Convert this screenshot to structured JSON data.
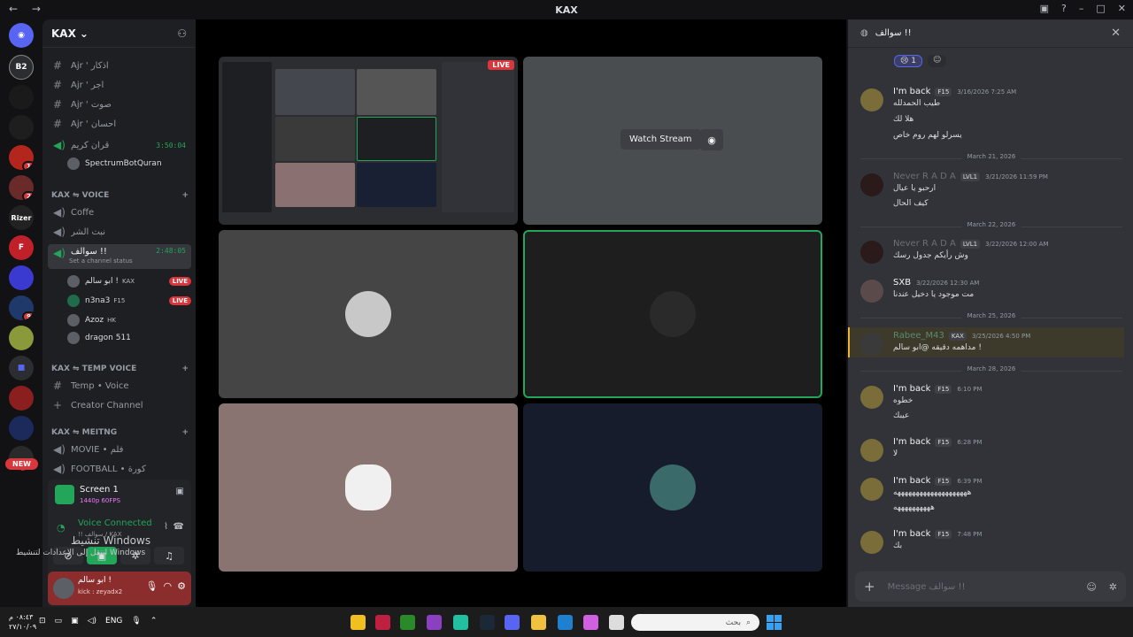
{
  "window": {
    "title": "KAX",
    "nav": "← →"
  },
  "guild": {
    "name": "KAX",
    "channels_top": [
      {
        "type": "text",
        "name": "Ajr ' اذكار"
      },
      {
        "type": "text",
        "name": "Ajr ' اجر"
      },
      {
        "type": "text",
        "name": "Ajr ' صوت"
      },
      {
        "type": "text",
        "name": "Ajr ' احسان"
      },
      {
        "type": "voice",
        "name": "قران كريم",
        "timer": "3:50:04"
      }
    ],
    "bot_user": "SpectrumBotQuran",
    "voice_category": "KAX ⇋ VOICE",
    "voice_channels": [
      {
        "name": "Coffe"
      },
      {
        "name": "نبت الشر"
      }
    ],
    "active_channel": {
      "name": "سوالف !!",
      "timer": "2:48:05",
      "status": "Set a channel status"
    },
    "voice_users": [
      {
        "name": "ابو سالم !",
        "tag": "KAX",
        "live": "LIVE"
      },
      {
        "name": "n3na3",
        "tag": "F15",
        "live": "LIVE"
      },
      {
        "name": "Azoz",
        "tag": "HK",
        "live": ""
      },
      {
        "name": "dragon 511",
        "tag": "",
        "live": ""
      }
    ],
    "temp_category": "KAX ⇋ TEMP VOICE",
    "temp_channels": [
      {
        "name": "Temp • Voice"
      },
      {
        "name": "Creator Channel"
      }
    ],
    "meet_category": "KAX ⇋ MEITNG",
    "meet_channels": [
      {
        "name": "MOVIE • فلم"
      },
      {
        "name": "FOOTBALL • كورة"
      }
    ]
  },
  "screen_panel": {
    "title": "Screen 1",
    "fps": "1440p 60FPS",
    "voice_status": "Voice Connected",
    "voice_location": "!! سوالف / KAX"
  },
  "user_panel": {
    "name": "ابو سالم !",
    "status": "kick : zeyadx2"
  },
  "windows_activation": {
    "line1": "تنشيط Windows",
    "line2": "انتقل إلى الإعدادات لتنشيط Windows"
  },
  "stage": {
    "watch_label": "Watch Stream",
    "live_label": "LIVE"
  },
  "chat": {
    "channel": "سوالف !!",
    "reaction_count": "1",
    "messages": [
      {
        "author": "I'm back",
        "tag": "F15",
        "time": "3/16/2026 7:25 AM",
        "lines": [
          "طيب الحمدلله",
          "هلا لك",
          "يسرلو لهم روم خاص"
        ]
      },
      {
        "divider": "March 21, 2026"
      },
      {
        "author": "Never R A D A",
        "tag": "LVL1",
        "time": "3/21/2026 11:59 PM",
        "lines": [
          "ارحبو يا عيال",
          "كيف الحال"
        ]
      },
      {
        "divider": "March 22, 2026"
      },
      {
        "author": "Never R A D A",
        "tag": "LVL1",
        "time": "3/22/2026 12:00 AM",
        "lines": [
          "وش رأيكم جدول رسك"
        ]
      },
      {
        "author": "SXB",
        "tag": "",
        "time": "3/22/2026 12:30 AM",
        "lines": [
          "مت موجود يا دخيل عندنا"
        ]
      },
      {
        "divider": "March 25, 2026"
      },
      {
        "author": "Rabee_M43",
        "tag": "KAX",
        "time": "3/25/2026 4:50 PM",
        "lines": [
          "مداهمه دقيقه @ابو سالم !"
        ]
      },
      {
        "divider": "March 28, 2026"
      },
      {
        "author": "I'm back",
        "tag": "F15",
        "time": "6:10 PM",
        "lines": [
          "خطوه",
          "عيبك"
        ]
      },
      {
        "author": "I'm back",
        "tag": "F15",
        "time": "6:28 PM",
        "lines": [
          "لا"
        ]
      },
      {
        "author": "I'm back",
        "tag": "F15",
        "time": "6:39 PM",
        "lines": [
          "ههههههههههههههههههههه",
          "ههههههههههه"
        ]
      },
      {
        "author": "I'm back",
        "tag": "F15",
        "time": "7:48 PM",
        "lines": [
          "بك"
        ]
      }
    ],
    "composer_placeholder": "Message سوالف !!"
  },
  "taskbar": {
    "time": "٠٨:٤٣ م",
    "date": "٢٧/١٠/٠٩",
    "lang": "ENG",
    "search_placeholder": "بحث"
  },
  "colors": {
    "accent": "#5865f2",
    "green": "#23a55a",
    "live": "#da373c",
    "highlight": "#f0b232"
  },
  "icons": {
    "discord_home": "discord-icon",
    "mic": "microphone-icon",
    "headset": "headset-icon",
    "settings": "gear-icon",
    "close": "close-icon",
    "plus": "plus-icon",
    "emoji": "emoji-icon",
    "watch": "eye-icon"
  }
}
